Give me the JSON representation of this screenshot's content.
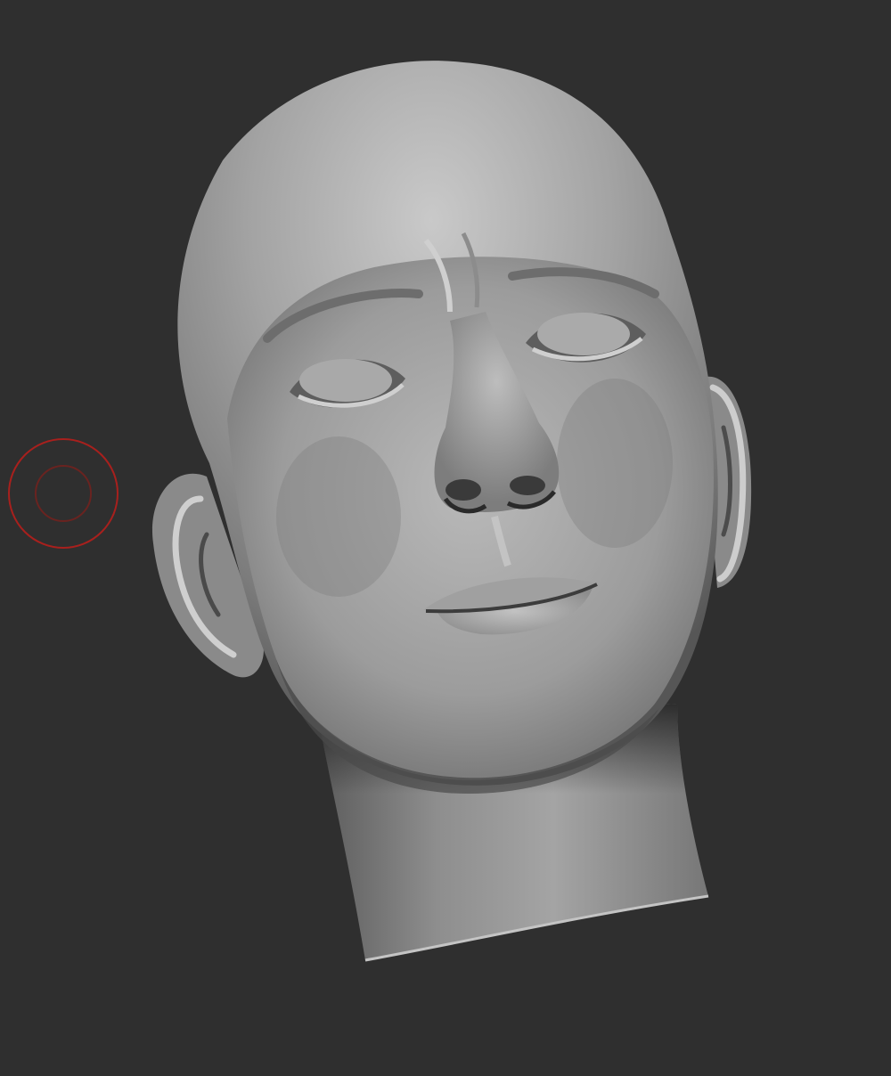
{
  "viewport": {
    "background_color": "#2f2f2f",
    "mesh_color": "#8f8f8f"
  },
  "model": {
    "subject": "sculpted-head"
  },
  "brush": {
    "outer_ring_color": "#a8201d",
    "inner_ring_color": "#6a2320"
  }
}
